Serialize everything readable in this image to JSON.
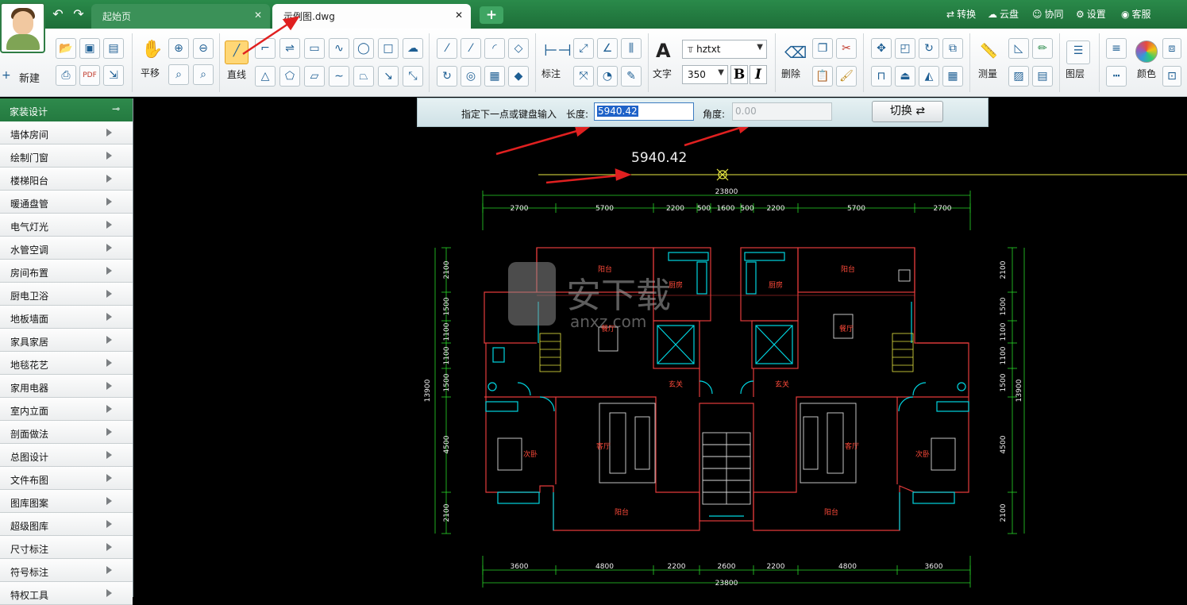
{
  "titlebar": {
    "tabs": [
      {
        "label": "起始页",
        "close": "✕"
      },
      {
        "label": "示例图.dwg",
        "close": "✕"
      }
    ],
    "add_tab": "+",
    "right_links": [
      "转换",
      "云盘",
      "协同",
      "设置",
      "客服"
    ]
  },
  "ribbon": {
    "new_label": "新建",
    "pan_label": "平移",
    "line_label": "直线",
    "dim_label": "标注",
    "text_label": "文字",
    "font_value": "hztxt",
    "size_value": "350",
    "bold": "B",
    "italic": "I",
    "delete_label": "删除",
    "measure_label": "测量",
    "layer_label": "图层",
    "color_label": "颜色",
    "text_icon": "A"
  },
  "sidebar": {
    "header": "家装设计",
    "items": [
      "墙体房间",
      "绘制门窗",
      "楼梯阳台",
      "暖通盘管",
      "电气灯光",
      "水管空调",
      "房间布置",
      "厨电卫浴",
      "地板墙面",
      "家具家居",
      "地毯花艺",
      "家用电器",
      "室内立面",
      "剖面做法",
      "总图设计",
      "文件布图",
      "图库图案",
      "超级图库",
      "尺寸标注",
      "符号标注",
      "特权工具"
    ]
  },
  "command": {
    "prompt": "指定下一点或键盘输入",
    "length_label": "长度:",
    "length_value": "5940.42",
    "angle_label": "角度:",
    "angle_value": "0.00",
    "switch_label": "切换",
    "switch_icon": "⇄"
  },
  "drawing": {
    "cursor_value": "5940.42",
    "total_width": "23800",
    "top_dims": [
      "2700",
      "5700",
      "2200",
      "500",
      "1600",
      "500",
      "2200",
      "5700",
      "2700"
    ],
    "bottom_dims": [
      "3600",
      "4800",
      "2200",
      "2600",
      "2200",
      "4800",
      "3600"
    ],
    "left_dims": [
      "2100",
      "1500",
      "1100",
      "1100",
      "1500",
      "4500",
      "2100"
    ],
    "right_dims": [
      "2100",
      "1500",
      "1100",
      "1100",
      "1500",
      "4500",
      "2100"
    ],
    "total_height": "13900",
    "rooms": [
      "阳台",
      "厨房",
      "餐厅",
      "玄关",
      "次卧",
      "客厅",
      "阳台",
      "阳台",
      "厨房",
      "餐厅",
      "玄关",
      "客厅",
      "次卧",
      "阳台"
    ],
    "watermark": "安下载",
    "watermark_url": "anxz.com"
  },
  "colors": {
    "accent": "#2a8a4a",
    "wall": "#e33b3b",
    "dim": "#28d728",
    "cyan": "#00d5e0",
    "yellow": "#e7e742",
    "annotation": "#e02020"
  }
}
